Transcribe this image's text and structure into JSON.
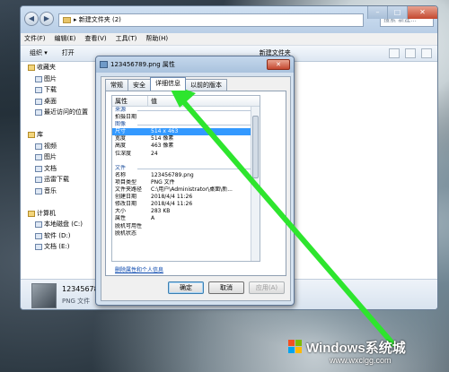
{
  "explorer": {
    "address": "▸ 新建文件夹 (2)",
    "search_placeholder": "搜索 新建...",
    "menu": [
      "文件(F)",
      "编辑(E)",
      "查看(V)",
      "工具(T)",
      "帮助(H)"
    ],
    "toolbar": {
      "organize": "组织 ▾",
      "open": "打开",
      "new_folder": "新建文件夹"
    },
    "nav": [
      {
        "label": "收藏夹",
        "head": true
      },
      {
        "label": "图片"
      },
      {
        "label": "下载"
      },
      {
        "label": "桌面"
      },
      {
        "label": "最近访问的位置"
      },
      {
        "label": ""
      },
      {
        "label": "库",
        "head": true
      },
      {
        "label": "视频"
      },
      {
        "label": "图片"
      },
      {
        "label": "文档"
      },
      {
        "label": "迅雷下载"
      },
      {
        "label": "音乐"
      },
      {
        "label": ""
      },
      {
        "label": "计算机",
        "head": true
      },
      {
        "label": "本地磁盘 (C:)"
      },
      {
        "label": "软件 (D:)"
      },
      {
        "label": "文档 (E:)"
      }
    ],
    "details": {
      "name": "123456789.png",
      "type": "PNG 文件"
    }
  },
  "dialog": {
    "title": "123456789.png 属性",
    "tabs": [
      "常规",
      "安全",
      "详细信息",
      "以前的版本"
    ],
    "active_tab": "详细信息",
    "col_property": "属性",
    "col_value": "值",
    "rows": [
      {
        "k": "来源",
        "section": true
      },
      {
        "k": "拍摄日期",
        "v": ""
      },
      {
        "k": "图像",
        "section": true
      },
      {
        "k": "尺寸",
        "v": "514 x 463",
        "selected": true
      },
      {
        "k": "宽度",
        "v": "514 像素"
      },
      {
        "k": "高度",
        "v": "463 像素"
      },
      {
        "k": "位深度",
        "v": "24"
      },
      {
        "k": "",
        "v": ""
      },
      {
        "k": "文件",
        "section": true
      },
      {
        "k": "名称",
        "v": "123456789.png"
      },
      {
        "k": "项目类型",
        "v": "PNG 文件"
      },
      {
        "k": "文件夹路径",
        "v": "C:\\用户\\Administrator\\桌面\\新..."
      },
      {
        "k": "创建日期",
        "v": "2018/4/4 11:26"
      },
      {
        "k": "修改日期",
        "v": "2018/4/4 11:26"
      },
      {
        "k": "大小",
        "v": "283 KB"
      },
      {
        "k": "属性",
        "v": "A"
      },
      {
        "k": "脱机可用性",
        "v": ""
      },
      {
        "k": "脱机状态",
        "v": ""
      }
    ],
    "remove_link": "删除属性和个人信息",
    "ok": "确定",
    "cancel": "取消",
    "apply": "应用(A)",
    "close": "✕"
  },
  "watermark": {
    "brand": "Windows系统城",
    "site": "www.wxclgg.com"
  },
  "colors": {
    "arrow": "#2ee52e",
    "selection": "#3399ff"
  }
}
